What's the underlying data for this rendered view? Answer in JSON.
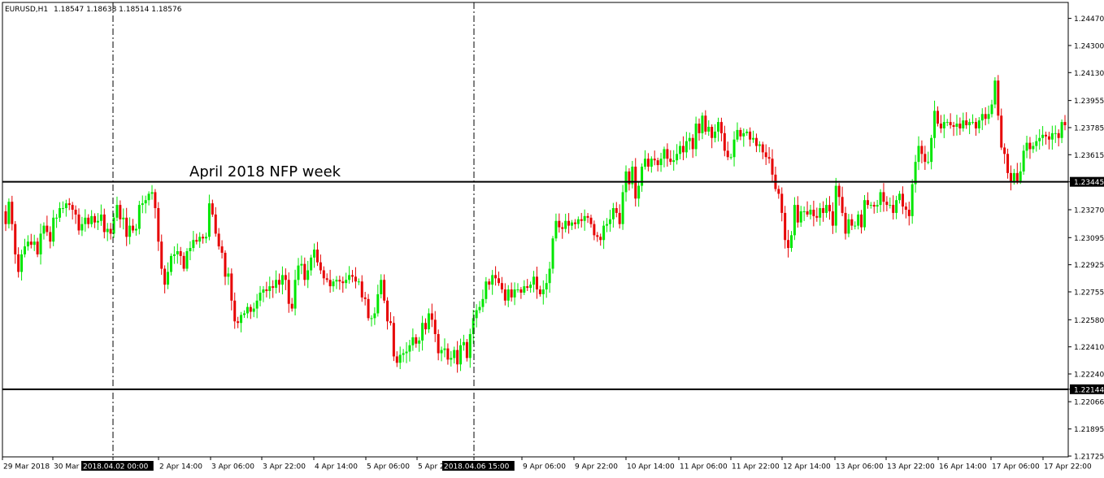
{
  "header": {
    "symbol": "EURUSD,H1",
    "ohlc": "1.18547 1.18638 1.18514 1.18576"
  },
  "annotation_text": "April 2018 NFP week",
  "colors": {
    "bull": "#00e600",
    "bear": "#e60000",
    "wick": "#000000",
    "level_line": "#000000",
    "background": "#ffffff",
    "label_bg": "#000000",
    "label_fg": "#ffffff"
  },
  "chart_data": {
    "type": "candlestick",
    "title": "EURUSD,H1",
    "ylim": [
      1.2172,
      1.2457
    ],
    "grid": false,
    "y_ticks": [
      "1.24470",
      "1.24300",
      "1.24130",
      "1.23955",
      "1.23785",
      "1.23615",
      "1.23445",
      "1.23270",
      "1.23095",
      "1.22925",
      "1.22755",
      "1.22580",
      "1.22410",
      "1.22240",
      "1.22144",
      "1.22066",
      "1.21895",
      "1.21725"
    ],
    "x_ticks": [
      "29 Mar 2018",
      "30 Mar",
      "2018.04.02 00:00",
      "2 Apr 14:00",
      "3 Apr 06:00",
      "3 Apr 22:00",
      "4 Apr 14:00",
      "5 Apr 06:00",
      "5 Apr 2",
      "2018.04.06 15:00",
      "9 Apr 06:00",
      "9 Apr 22:00",
      "10 Apr 14:00",
      "11 Apr 06:00",
      "11 Apr 22:00",
      "12 Apr 14:00",
      "13 Apr 06:00",
      "13 Apr 22:00",
      "16 Apr 14:00",
      "17 Apr 06:00",
      "17 Apr 22:00"
    ],
    "highlight_x_labels": [
      "2018.04.02 00:00",
      "2018.04.06 15:00"
    ],
    "horizontal_levels": [
      {
        "value": 1.23445,
        "label": "1.23445"
      },
      {
        "value": 1.22144,
        "label": "1.22144"
      }
    ],
    "vertical_markers": [
      "2018.04.02 00:00",
      "2018.04.06 15:00"
    ],
    "series": [
      {
        "closes": [
          1.2318,
          1.2332,
          1.2318,
          1.2299,
          1.2288,
          1.2299,
          1.2304,
          1.2307,
          1.2305,
          1.2307,
          1.2299,
          1.2312,
          1.2317,
          1.2313,
          1.2307,
          1.2322,
          1.2322,
          1.2328,
          1.2328,
          1.2331,
          1.233,
          1.2327,
          1.2324,
          1.2314,
          1.2318,
          1.2322,
          1.2318,
          1.2323,
          1.2319,
          1.232,
          1.2324,
          1.2313,
          1.2315,
          1.2312,
          1.2322,
          1.233,
          1.2321,
          1.2322,
          1.231,
          1.2317,
          1.2314,
          1.2315,
          1.233,
          1.2331,
          1.2333,
          1.2337,
          1.2338,
          1.2328,
          1.2307,
          1.229,
          1.228,
          1.2288,
          1.2298,
          1.2299,
          1.2301,
          1.2298,
          1.229,
          1.2301,
          1.2303,
          1.2308,
          1.2307,
          1.231,
          1.2309,
          1.231,
          1.2331,
          1.2324,
          1.2312,
          1.2304,
          1.23,
          1.2285,
          1.2287,
          1.227,
          1.2257,
          1.2256,
          1.2261,
          1.2262,
          1.2266,
          1.2263,
          1.2265,
          1.227,
          1.2275,
          1.2277,
          1.2276,
          1.2279,
          1.2278,
          1.2283,
          1.228,
          1.2286,
          1.2283,
          1.2268,
          1.2265,
          1.2283,
          1.2292,
          1.2293,
          1.2283,
          1.2289,
          1.2297,
          1.2302,
          1.2294,
          1.2289,
          1.2284,
          1.2283,
          1.2279,
          1.2282,
          1.2283,
          1.2282,
          1.2281,
          1.2283,
          1.2286,
          1.2285,
          1.2282,
          1.2282,
          1.2272,
          1.2271,
          1.2259,
          1.2259,
          1.2262,
          1.2274,
          1.2283,
          1.227,
          1.2257,
          1.2256,
          1.2235,
          1.2231,
          1.2236,
          1.2237,
          1.2238,
          1.2242,
          1.2247,
          1.2243,
          1.2245,
          1.2256,
          1.2252,
          1.2262,
          1.2258,
          1.2249,
          1.2237,
          1.2239,
          1.224,
          1.2233,
          1.2234,
          1.2239,
          1.223,
          1.2242,
          1.2244,
          1.2234,
          1.2249,
          1.2259,
          1.2264,
          1.2266,
          1.2271,
          1.2282,
          1.228,
          1.2286,
          1.2284,
          1.2281,
          1.2277,
          1.227,
          1.2277,
          1.2272,
          1.2277,
          1.2277,
          1.2275,
          1.2279,
          1.2278,
          1.228,
          1.2285,
          1.2277,
          1.2274,
          1.2277,
          1.2281,
          1.229,
          1.2309,
          1.232,
          1.2316,
          1.2315,
          1.232,
          1.2317,
          1.2319,
          1.2318,
          1.2321,
          1.232,
          1.2323,
          1.2322,
          1.2318,
          1.2311,
          1.231,
          1.2308,
          1.2317,
          1.2318,
          1.2321,
          1.2328,
          1.2325,
          1.2318,
          1.2338,
          1.2351,
          1.2343,
          1.2354,
          1.2334,
          1.2342,
          1.2354,
          1.2359,
          1.2354,
          1.2359,
          1.2358,
          1.2355,
          1.2359,
          1.2365,
          1.2359,
          1.2357,
          1.2358,
          1.2362,
          1.2367,
          1.2363,
          1.237,
          1.2372,
          1.2365,
          1.2381,
          1.2375,
          1.2386,
          1.2376,
          1.2379,
          1.2372,
          1.2376,
          1.2382,
          1.2375,
          1.2364,
          1.236,
          1.236,
          1.2371,
          1.2377,
          1.2373,
          1.2375,
          1.2376,
          1.2371,
          1.2372,
          1.2367,
          1.2368,
          1.2363,
          1.236,
          1.2359,
          1.2349,
          1.234,
          1.2337,
          1.2325,
          1.2308,
          1.2303,
          1.2311,
          1.233,
          1.2319,
          1.2326,
          1.2326,
          1.2324,
          1.2327,
          1.2323,
          1.2322,
          1.2328,
          1.2325,
          1.233,
          1.2326,
          1.2317,
          1.2342,
          1.2335,
          1.2325,
          1.2312,
          1.2321,
          1.2317,
          1.2317,
          1.2324,
          1.2316,
          1.2333,
          1.233,
          1.233,
          1.2329,
          1.233,
          1.2338,
          1.2332,
          1.233,
          1.233,
          1.2325,
          1.2333,
          1.2337,
          1.2329,
          1.2327,
          1.2323,
          1.2343,
          1.2357,
          1.2367,
          1.2362,
          1.2357,
          1.2357,
          1.2372,
          1.2389,
          1.2381,
          1.2378,
          1.2382,
          1.2382,
          1.238,
          1.2379,
          1.2381,
          1.2378,
          1.2383,
          1.238,
          1.2382,
          1.2382,
          1.2378,
          1.2383,
          1.2387,
          1.2384,
          1.2387,
          1.2393,
          1.2408,
          1.2386,
          1.2366,
          1.2362,
          1.235,
          1.2345,
          1.235,
          1.2345,
          1.2351,
          1.2364,
          1.2369,
          1.2365,
          1.2367,
          1.237,
          1.2372,
          1.2374,
          1.2373,
          1.2371,
          1.2375,
          1.2375,
          1.2372,
          1.2382,
          1.238
        ]
      }
    ]
  }
}
